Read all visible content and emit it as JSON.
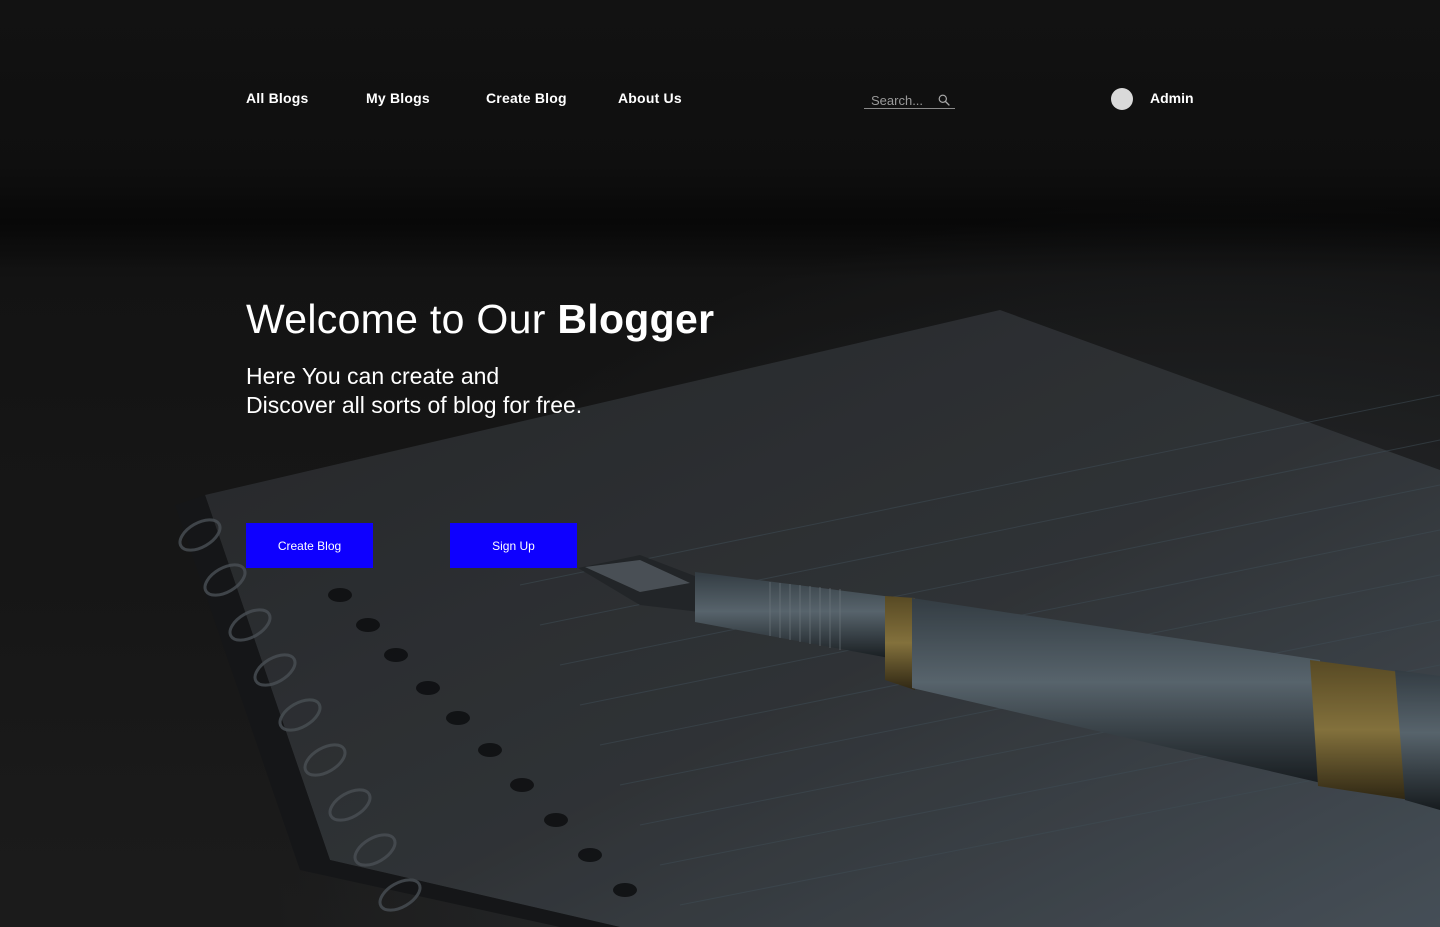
{
  "nav": {
    "links": [
      "All Blogs",
      "My Blogs",
      "Create Blog",
      "About Us"
    ]
  },
  "search": {
    "placeholder": "Search...",
    "icon": "magnifier"
  },
  "user": {
    "name": "Admin",
    "avatar_color": "#d9d9d9"
  },
  "hero": {
    "title_prefix": "Welcome to Our ",
    "title_bold": "Blogger",
    "subtitle_line1": "Here You can create and",
    "subtitle_line2": "Discover all sorts of blog for free."
  },
  "buttons": {
    "create_blog": "Create Blog",
    "sign_up": "Sign Up"
  },
  "colors": {
    "accent": "#0e00ff",
    "background": "#141414",
    "text": "#ffffff"
  }
}
